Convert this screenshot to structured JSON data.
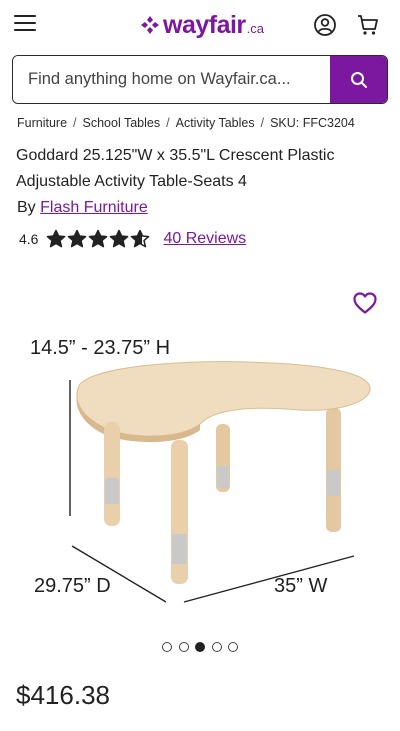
{
  "header": {
    "logo_text": "wayfair",
    "logo_tld": ".ca",
    "brand_color": "#7b189f",
    "icons": [
      "menu-icon",
      "account-icon",
      "cart-icon"
    ]
  },
  "search": {
    "placeholder": "Find anything home on Wayfair.ca...",
    "button_icon": "search-icon"
  },
  "breadcrumb": {
    "items": [
      "Furniture",
      "School Tables",
      "Activity Tables"
    ],
    "sku": "SKU: FFC3204"
  },
  "product": {
    "title": "Goddard 25.125\"W x 35.5\"L Crescent Plastic Adjustable Activity Table-Seats 4",
    "by_label": "By",
    "brand": "Flash Furniture",
    "rating": "4.6",
    "stars_filled": 4.6,
    "reviews_label": "40 Reviews",
    "price": "$416.38"
  },
  "image": {
    "height_label": "14.5” - 23.75” H",
    "depth_label": "29.75” D",
    "width_label": "35” W"
  },
  "carousel": {
    "total": 5,
    "active_index": 2
  }
}
